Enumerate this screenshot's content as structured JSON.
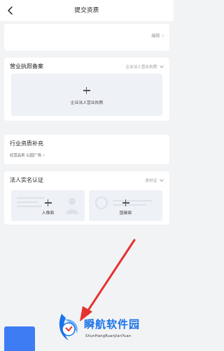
{
  "header": {
    "title": "提交资质"
  },
  "top_card": {
    "edit_label": "编辑"
  },
  "license_section": {
    "title": "营业执照备案",
    "select_value": "企业法人营业执照",
    "upload_label": "企业法人营业执照"
  },
  "industry_section": {
    "title": "行业资质补充",
    "subtitle": "经营品类 公园广场"
  },
  "realname_section": {
    "title": "法人实名认证",
    "select_value": "身份证",
    "front_label": "人像面",
    "back_label": "国徽面"
  },
  "watermark": {
    "name": "瞬航软件园",
    "subtitle": "ShunHangRuanJianYuan"
  },
  "colors": {
    "accent": "#3d7cf3",
    "arrow": "#e5322d",
    "upload_bg": "#eef1f5"
  }
}
